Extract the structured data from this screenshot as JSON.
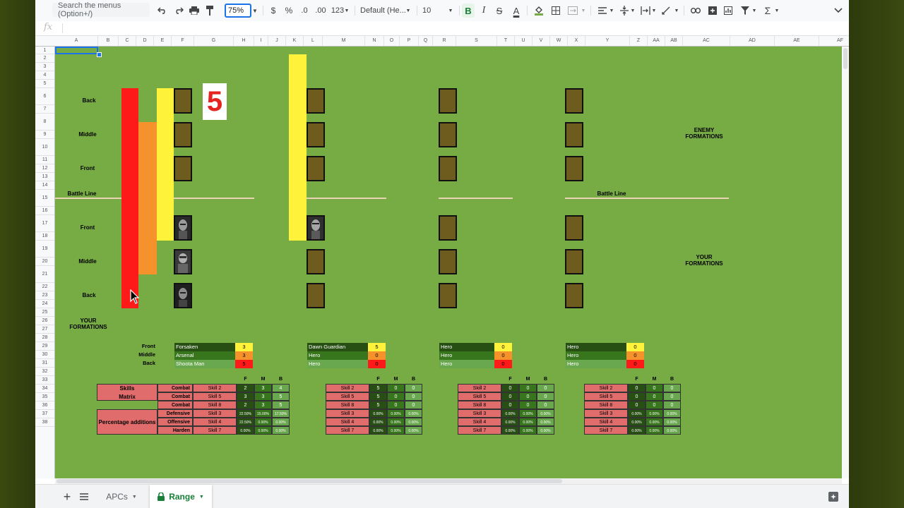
{
  "toolbar": {
    "search_placeholder": "Search the menus (Option+/)",
    "zoom": "75%",
    "currency": "$",
    "percent": "%",
    "dec_decrease": ".0",
    "dec_increase": ".00",
    "format_more": "123",
    "font": "Default (He...",
    "font_size": "10",
    "bold": "B",
    "italic": "I",
    "strike": "S",
    "text_color": "A"
  },
  "formula": {
    "fx": "fx"
  },
  "columns": [
    "A",
    "B",
    "C",
    "D",
    "E",
    "F",
    "G",
    "H",
    "I",
    "J",
    "K",
    "L",
    "M",
    "N",
    "O",
    "P",
    "Q",
    "R",
    "S",
    "T",
    "U",
    "V",
    "W",
    "X",
    "Y",
    "Z",
    "AA",
    "AB",
    "AC",
    "AD",
    "AE",
    "AF"
  ],
  "rows": [
    "1",
    "2",
    "3",
    "4",
    "5",
    "6",
    "7",
    "8",
    "9",
    "10",
    "11",
    "12",
    "13",
    "14",
    "15",
    "16",
    "17",
    "18",
    "19",
    "20",
    "21",
    "22",
    "23",
    "24",
    "25",
    "26",
    "27",
    "28",
    "29",
    "30",
    "31",
    "32",
    "33",
    "34",
    "35",
    "36",
    "37",
    "38"
  ],
  "sheet": {
    "row_labels": {
      "enemy_back": "Back",
      "enemy_middle": "Middle",
      "enemy_front": "Front",
      "battle_line": "Battle Line",
      "your_front": "Front",
      "your_middle": "Middle",
      "your_back": "Back",
      "your_formations": "YOUR FORMATIONS"
    },
    "big_number": "5",
    "enemy_formations": "ENEMY FORMATIONS",
    "your_formations_right": "YOUR FORMATIONS",
    "battle_line_right": "Battle Line",
    "unit_row_labels": [
      "Front",
      "Middle",
      "Back"
    ],
    "formations": [
      {
        "units": [
          {
            "name": "Forsaken",
            "value": "3"
          },
          {
            "name": "Arsenal",
            "value": "3"
          },
          {
            "name": "Shoota Man",
            "value": "5"
          }
        ]
      },
      {
        "units": [
          {
            "name": "Dawn Guardian",
            "value": "5"
          },
          {
            "name": "Hero",
            "value": "0"
          },
          {
            "name": "Hero",
            "value": "0"
          }
        ]
      },
      {
        "units": [
          {
            "name": "Hero",
            "value": "0"
          },
          {
            "name": "Hero",
            "value": "0"
          },
          {
            "name": "Hero",
            "value": "0"
          }
        ]
      },
      {
        "units": [
          {
            "name": "Hero",
            "value": "0"
          },
          {
            "name": "Hero",
            "value": "0"
          },
          {
            "name": "Hero",
            "value": "0"
          }
        ]
      }
    ],
    "matrix_labels": {
      "skills": "Skills",
      "matrix": "Matrix",
      "percentage": "Percentage additions",
      "combat": "Combat",
      "defensive": "Defensive",
      "offensive": "Offensive",
      "harden": "Harden",
      "col_f": "F",
      "col_m": "M",
      "col_b": "B"
    },
    "matrices": [
      {
        "rows": [
          {
            "skill": "Skill 2",
            "f": "2",
            "m": "3",
            "b": "4"
          },
          {
            "skill": "Skill 5",
            "f": "3",
            "m": "3",
            "b": "5"
          },
          {
            "skill": "Skill 8",
            "f": "2",
            "m": "3",
            "b": "5"
          },
          {
            "skill": "Skill 3",
            "f": "22.50%",
            "m": "15.00%",
            "b": "17.50%"
          },
          {
            "skill": "Skill 4",
            "f": "22.50%",
            "m": "0.00%",
            "b": "0.00%"
          },
          {
            "skill": "Skill 7",
            "f": "0.00%",
            "m": "0.00%",
            "b": "0.00%"
          }
        ]
      },
      {
        "rows": [
          {
            "skill": "Skill 2",
            "f": "5",
            "m": "0",
            "b": "0"
          },
          {
            "skill": "Skill 5",
            "f": "5",
            "m": "0",
            "b": "0"
          },
          {
            "skill": "Skill 8",
            "f": "5",
            "m": "0",
            "b": "0"
          },
          {
            "skill": "Skill 3",
            "f": "0.00%",
            "m": "0.00%",
            "b": "0.00%"
          },
          {
            "skill": "Skill 4",
            "f": "0.00%",
            "m": "0.00%",
            "b": "0.00%"
          },
          {
            "skill": "Skill 7",
            "f": "0.00%",
            "m": "0.00%",
            "b": "0.00%"
          }
        ]
      },
      {
        "rows": [
          {
            "skill": "Skill 2",
            "f": "0",
            "m": "0",
            "b": "0"
          },
          {
            "skill": "Skill 5",
            "f": "0",
            "m": "0",
            "b": "0"
          },
          {
            "skill": "Skill 8",
            "f": "0",
            "m": "0",
            "b": "0"
          },
          {
            "skill": "Skill 3",
            "f": "0.00%",
            "m": "0.00%",
            "b": "0.00%"
          },
          {
            "skill": "Skill 4",
            "f": "0.00%",
            "m": "0.00%",
            "b": "0.00%"
          },
          {
            "skill": "Skill 7",
            "f": "0.00%",
            "m": "0.00%",
            "b": "0.00%"
          }
        ]
      },
      {
        "rows": [
          {
            "skill": "Skill 2",
            "f": "0",
            "m": "0",
            "b": "0"
          },
          {
            "skill": "Skill 5",
            "f": "0",
            "m": "0",
            "b": "0"
          },
          {
            "skill": "Skill 8",
            "f": "0",
            "m": "0",
            "b": "0"
          },
          {
            "skill": "Skill 3",
            "f": "0.00%",
            "m": "0.00%",
            "b": "0.00%"
          },
          {
            "skill": "Skill 4",
            "f": "0.00%",
            "m": "0.00%",
            "b": "0.00%"
          },
          {
            "skill": "Skill 7",
            "f": "0.00%",
            "m": "0.00%",
            "b": "0.00%"
          }
        ]
      }
    ]
  },
  "tabs": [
    {
      "label": "APCs"
    },
    {
      "label": "Range",
      "active": true
    }
  ],
  "colors": {
    "sheet_bg": "#77ab44",
    "red": "#ff1a1a",
    "orange": "#f6922b",
    "yellow": "#fff23a",
    "slot": "#6e5b1e",
    "cell_red": "#e06c6c"
  },
  "icons": [
    "undo-icon",
    "redo-icon",
    "print-icon",
    "paint-format-icon",
    "fill-color-icon",
    "borders-icon",
    "merge-icon",
    "align-icon",
    "valign-icon",
    "wrap-icon",
    "rotate-icon",
    "link-icon",
    "comment-icon",
    "chart-icon",
    "filter-icon",
    "functions-icon",
    "collapse-icon",
    "add-sheet-icon",
    "all-sheets-icon",
    "lock-icon",
    "explore-icon"
  ]
}
